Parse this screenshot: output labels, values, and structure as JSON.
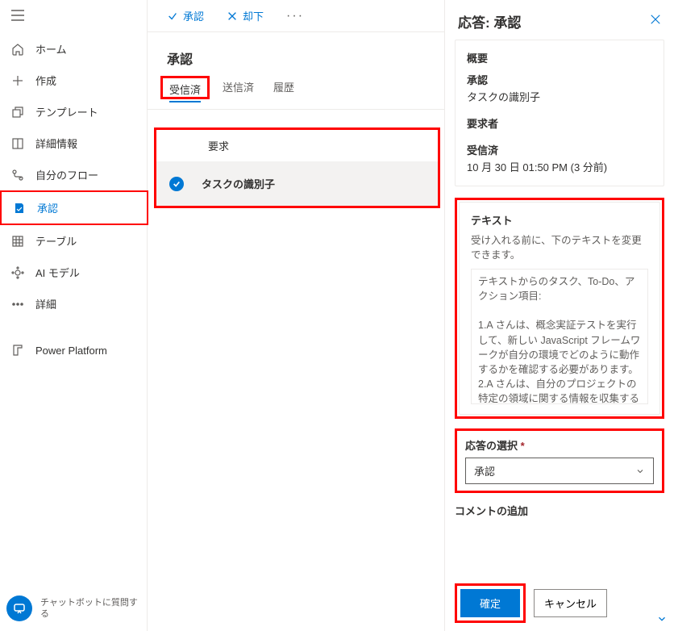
{
  "sidebar": {
    "items": [
      {
        "label": "ホーム",
        "icon": "home-icon"
      },
      {
        "label": "作成",
        "icon": "plus-icon"
      },
      {
        "label": "テンプレート",
        "icon": "template-icon"
      },
      {
        "label": "詳細情報",
        "icon": "book-icon"
      },
      {
        "label": "自分のフロー",
        "icon": "flow-icon"
      },
      {
        "label": "承認",
        "icon": "approve-icon",
        "active": true
      },
      {
        "label": "テーブル",
        "icon": "table-icon"
      },
      {
        "label": "AI モデル",
        "icon": "ai-icon"
      },
      {
        "label": "詳細",
        "icon": "more-icon"
      },
      {
        "label": "Power Platform",
        "icon": "platform-icon"
      }
    ],
    "chatbot": "チャットボットに質問する"
  },
  "toolbar": {
    "approve": "承認",
    "reject": "却下"
  },
  "page": {
    "title": "承認"
  },
  "tabs": {
    "received": "受信済",
    "sent": "送信済",
    "history": "履歴"
  },
  "table": {
    "col_request": "要求",
    "row1_title": "タスクの識別子"
  },
  "panel": {
    "title": "応答: 承認",
    "overview_label": "概要",
    "approval_label": "承認",
    "task_id": "タスクの識別子",
    "requester_label": "要求者",
    "received_label": "受信済",
    "received_time": "10 月 30 日 01:50 PM (3 分前)",
    "text_label": "テキスト",
    "text_help": "受け入れる前に、下のテキストを変更できます。",
    "text_content": "テキストからのタスク、To-Do、アクション項目:\n\n1.A さんは、概念実証テストを実行して、新しい JavaScript フレームワークが自分の環境でどのように動作するかを確認する必要があります。\n2.A さんは、自分のプロジェクトの特定の領域に関する情報を収集する必要があります",
    "response_label": "応答の選択",
    "response_value": "承認",
    "comment_label": "コメントの追加",
    "confirm_btn": "確定",
    "cancel_btn": "キャンセル"
  }
}
